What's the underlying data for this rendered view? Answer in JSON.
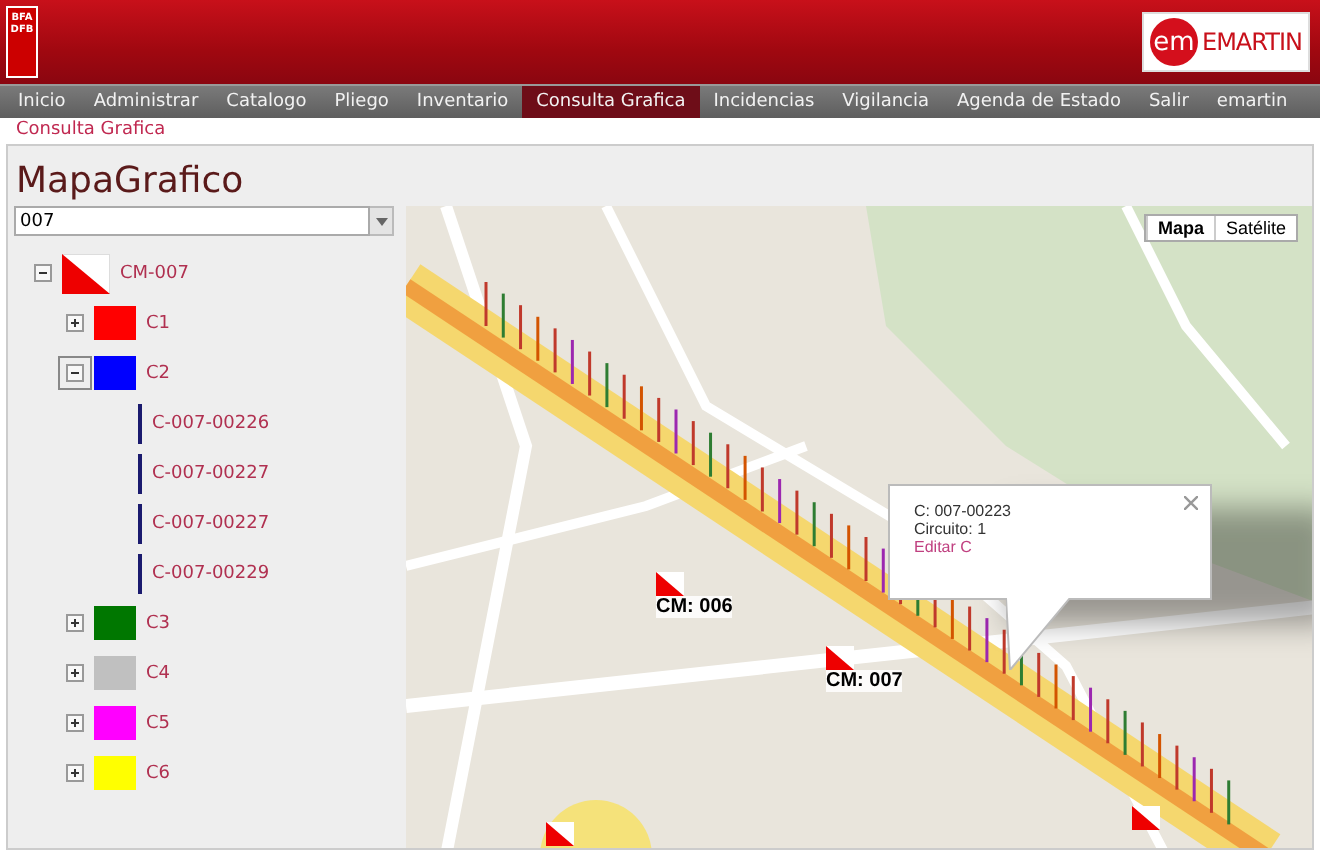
{
  "header": {
    "logo_text": [
      "BFA",
      "DFB"
    ],
    "brand": {
      "mark": "em",
      "name": "EMARTIN"
    }
  },
  "nav": [
    {
      "label": "Inicio",
      "selected": false
    },
    {
      "label": "Administrar",
      "selected": false
    },
    {
      "label": "Catalogo",
      "selected": false
    },
    {
      "label": "Pliego",
      "selected": false
    },
    {
      "label": "Inventario",
      "selected": false
    },
    {
      "label": "Consulta Grafica",
      "selected": true
    },
    {
      "label": "Incidencias",
      "selected": false
    },
    {
      "label": "Vigilancia",
      "selected": false
    },
    {
      "label": "Agenda de Estado",
      "selected": false
    },
    {
      "label": "Salir",
      "selected": false
    },
    {
      "label": "emartin",
      "selected": false
    }
  ],
  "breadcrumb": "Consulta Grafica",
  "page_title": "MapaGrafico",
  "search": {
    "value": "007"
  },
  "tree": [
    {
      "label": "CM-007",
      "kind": "cm",
      "expanded": true,
      "children": [
        {
          "label": "C1",
          "kind": "circuit",
          "color": "#ff0000",
          "expanded": false
        },
        {
          "label": "C2",
          "kind": "circuit",
          "color": "#0000ff",
          "expanded": true,
          "children": [
            {
              "label": "C-007-00226",
              "kind": "line",
              "color": "#1a1a6e"
            },
            {
              "label": "C-007-00227",
              "kind": "line",
              "color": "#1a1a6e"
            },
            {
              "label": "C-007-00227",
              "kind": "line",
              "color": "#1a1a6e"
            },
            {
              "label": "C-007-00229",
              "kind": "line",
              "color": "#1a1a6e"
            }
          ]
        },
        {
          "label": "C3",
          "kind": "circuit",
          "color": "#007700",
          "expanded": false
        },
        {
          "label": "C4",
          "kind": "circuit",
          "color": "#c0c0c0",
          "expanded": false
        },
        {
          "label": "C5",
          "kind": "circuit",
          "color": "#ff00ff",
          "expanded": false
        },
        {
          "label": "C6",
          "kind": "circuit",
          "color": "#ffff00",
          "expanded": false
        }
      ]
    }
  ],
  "map": {
    "types": [
      {
        "label": "Mapa",
        "selected": true
      },
      {
        "label": "Satélite",
        "selected": false
      }
    ],
    "markers": [
      {
        "label": "CM: 006"
      },
      {
        "label": "CM: 007"
      }
    ],
    "popup": {
      "lines": [
        "C: 007-00223",
        "Circuito: 1"
      ],
      "link": "Editar C"
    }
  }
}
